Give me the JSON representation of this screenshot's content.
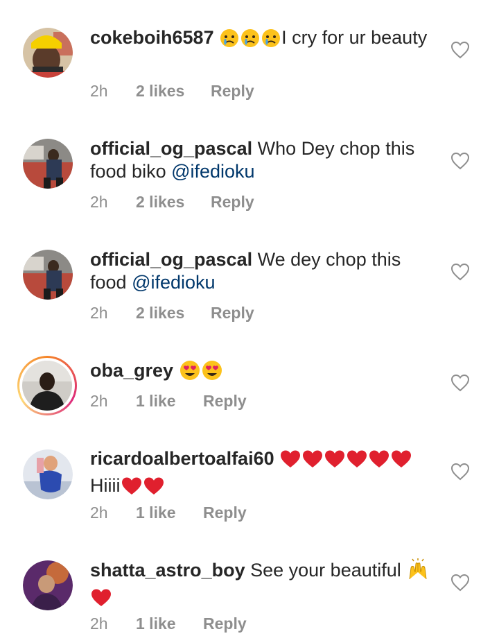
{
  "comments": [
    {
      "username": "cokeboih6587",
      "text_before": "",
      "emojis": [
        "crying-face",
        "crying-face",
        "crying-face"
      ],
      "text": "I cry for ur beauty",
      "mention": "",
      "trailing_emojis": [],
      "time": "2h",
      "likes": "2 likes",
      "reply": "Reply",
      "avatar_colors": [
        "#f5d000",
        "#2b2b2b",
        "#c8423a"
      ]
    },
    {
      "username": "official_og_pascal",
      "text": "Who Dey chop this food biko ",
      "mention": "@ifedioku",
      "time": "2h",
      "likes": "2 likes",
      "reply": "Reply",
      "avatar_colors": [
        "#9a8f86",
        "#2d3a55",
        "#c24a3a"
      ]
    },
    {
      "username": "official_og_pascal",
      "text": "We dey chop this food ",
      "mention": "@ifedioku",
      "time": "2h",
      "likes": "2 likes",
      "reply": "Reply",
      "avatar_colors": [
        "#9a8f86",
        "#2d3a55",
        "#c24a3a"
      ]
    },
    {
      "username": "oba_grey",
      "emojis": [
        "heart-eyes-face",
        "heart-eyes-face"
      ],
      "time": "2h",
      "likes": "1 like",
      "reply": "Reply",
      "avatar_colors": [
        "#c9c6c2",
        "#1e1e1e",
        "#6c6a67"
      ]
    },
    {
      "username": "ricardoalbertoalfai60",
      "emojis": [
        "red-heart",
        "red-heart",
        "red-heart",
        "red-heart",
        "red-heart",
        "red-heart"
      ],
      "text": "Hiiii",
      "trailing_emojis": [
        "red-heart",
        "red-heart"
      ],
      "time": "2h",
      "likes": "1 like",
      "reply": "Reply",
      "avatar_colors": [
        "#dfe4ec",
        "#2c4bb0",
        "#e7a1a8"
      ]
    },
    {
      "username": "shatta_astro_boy",
      "text": "See your beautiful ",
      "emojis": [
        "raising-hands"
      ],
      "trailing_emojis": [
        "red-heart"
      ],
      "time": "2h",
      "likes": "1 like",
      "reply": "Reply",
      "avatar_colors": [
        "#7b3a8a",
        "#e07a2f",
        "#3a1f4a"
      ]
    }
  ],
  "colors": {
    "text": "#262626",
    "meta": "#8e8e8e",
    "mention": "#00376b",
    "heart_outline": "#8e8e8e"
  }
}
